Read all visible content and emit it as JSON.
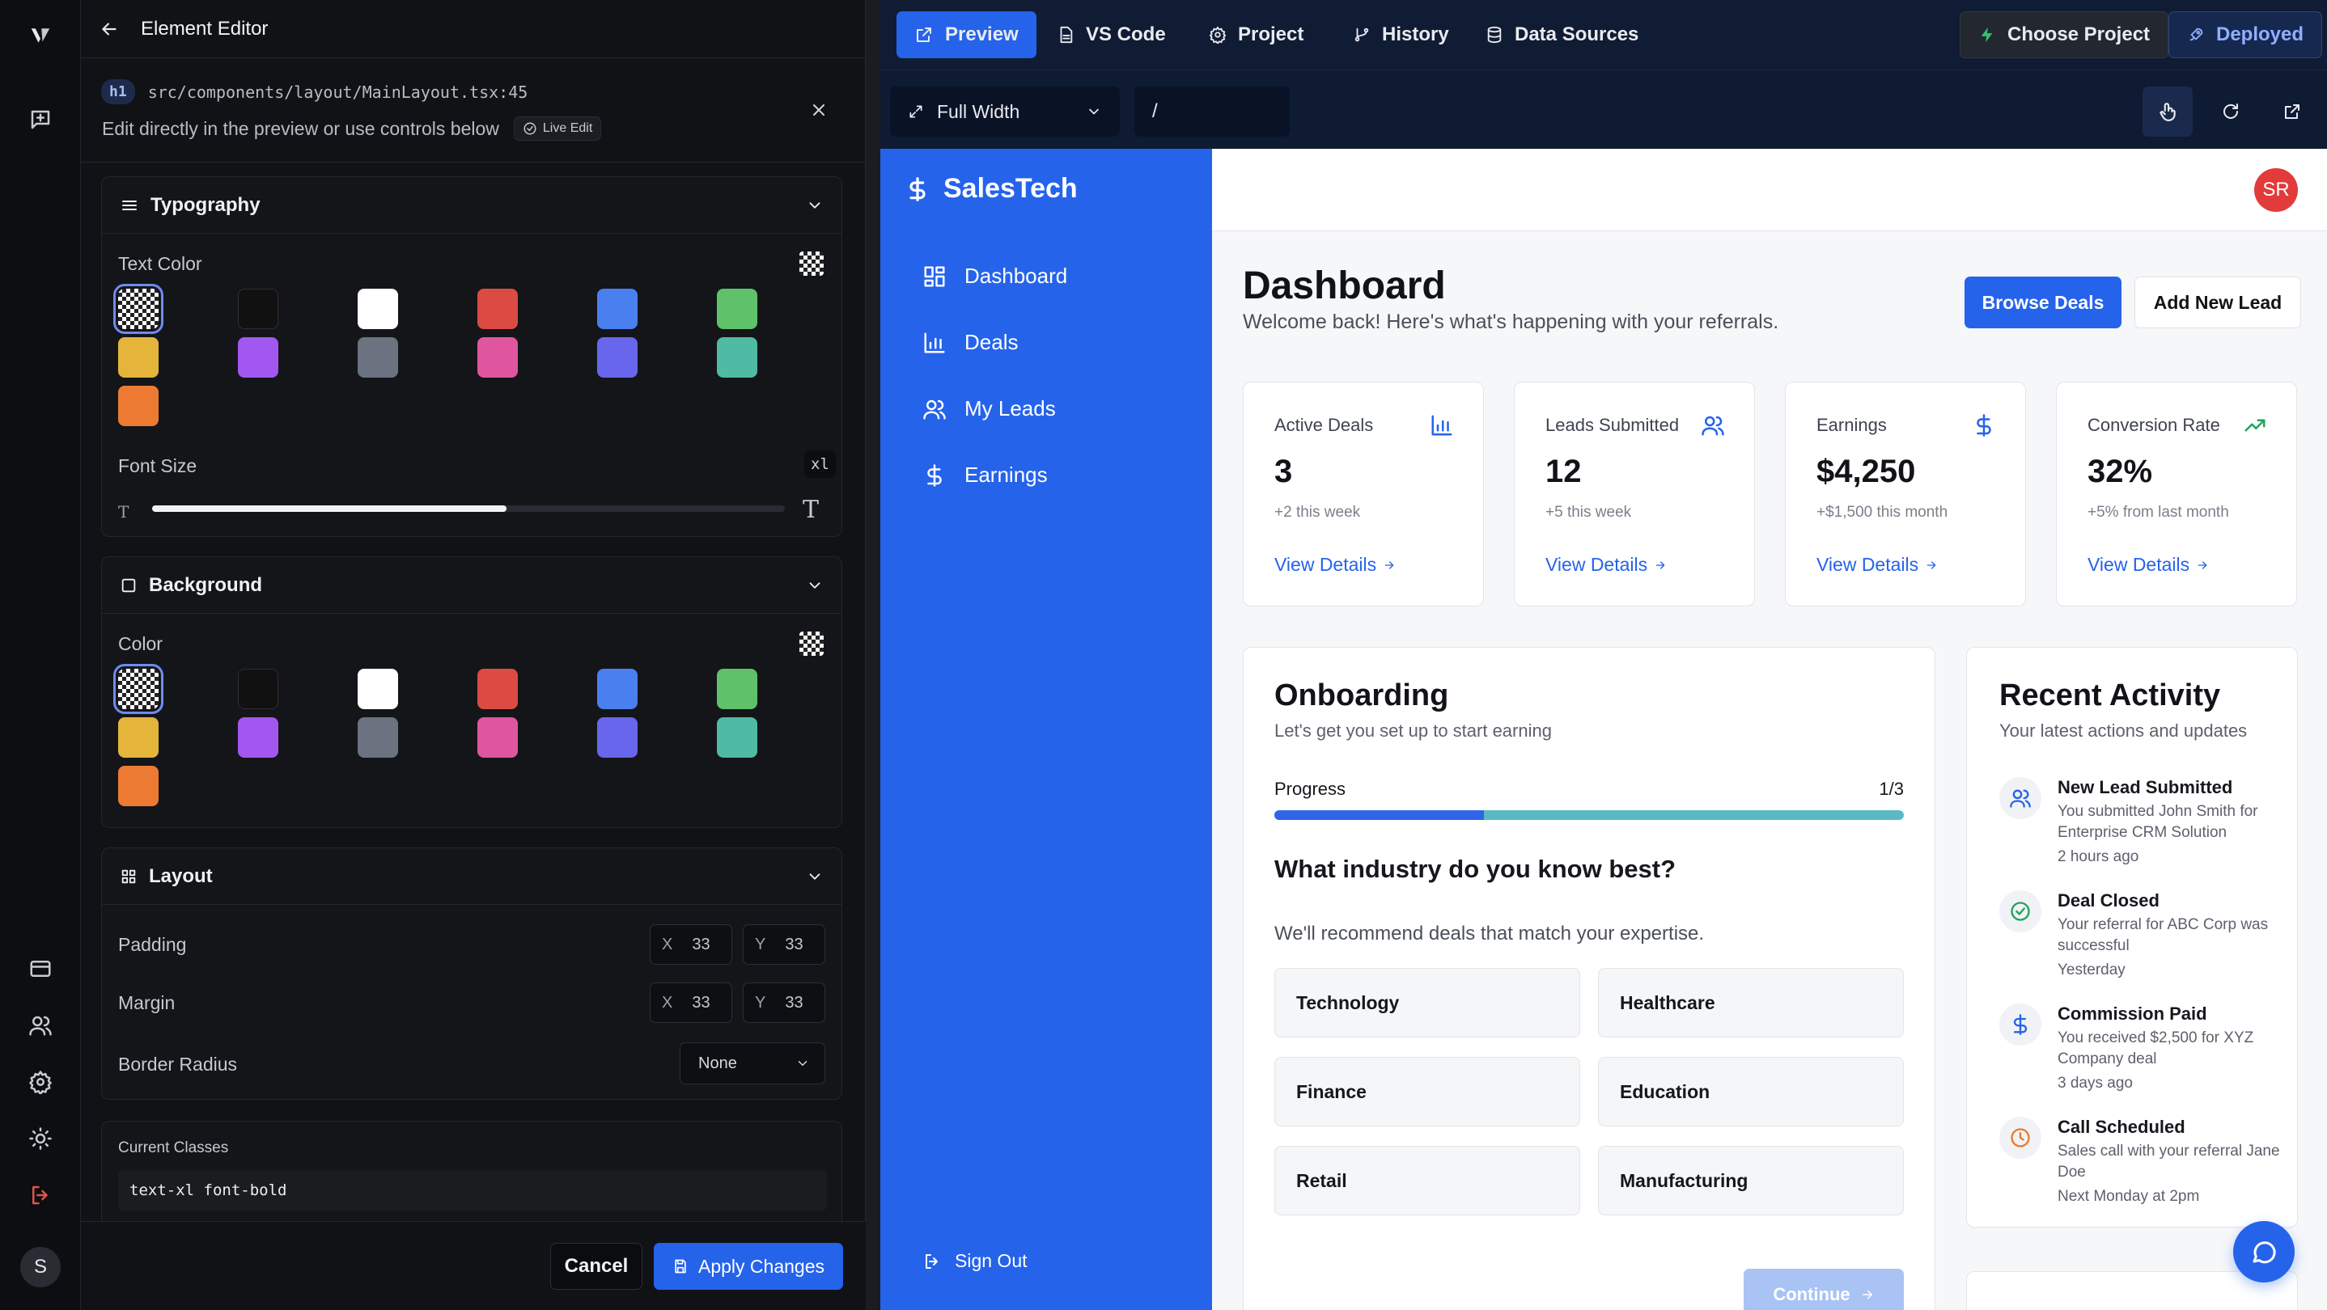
{
  "rail": {
    "logo": "V",
    "user_initial": "S"
  },
  "editor": {
    "title": "Element Editor",
    "tag": "h1",
    "path": "src/components/layout/MainLayout.tsx:45",
    "hint": "Edit directly in the preview or use controls below",
    "live_badge": "Live Edit",
    "typography": {
      "title": "Typography",
      "text_color_label": "Text Color",
      "font_size_label": "Font Size",
      "font_size_value": "xl",
      "font_size_fraction": 0.56
    },
    "background": {
      "title": "Background",
      "color_label": "Color"
    },
    "swatches": [
      "transparent",
      "#111111",
      "#ffffff",
      "#dc4b43",
      "#4a7ff0",
      "#5fc16a",
      "#e5b43a",
      "#a257f0",
      "#6b7280",
      "#e0569e",
      "#6766ec",
      "#4fbba4",
      "#ec7a32"
    ],
    "layout": {
      "title": "Layout",
      "padding_label": "Padding",
      "margin_label": "Margin",
      "radius_label": "Border Radius",
      "x_label": "X",
      "y_label": "Y",
      "padding_x": "33",
      "padding_y": "33",
      "margin_x": "33",
      "margin_y": "33",
      "radius_value": "None"
    },
    "classes_label": "Current Classes",
    "classes_value": "text-xl font-bold",
    "cancel": "Cancel",
    "apply": "Apply Changes"
  },
  "topbar": {
    "tabs": [
      "Preview",
      "VS Code",
      "Project",
      "History",
      "Data Sources"
    ],
    "choose_project": "Choose Project",
    "deployed": "Deployed",
    "width_select": "Full Width",
    "route": "/"
  },
  "app": {
    "brand": "SalesTech",
    "nav": [
      "Dashboard",
      "Deals",
      "My Leads",
      "Earnings"
    ],
    "sign_out": "Sign Out",
    "avatar": "SR",
    "title": "Dashboard",
    "subtitle": "Welcome back! Here's what's happening with your referrals.",
    "browse_deals": "Browse Deals",
    "add_lead": "Add New Lead",
    "stats": [
      {
        "title": "Active Deals",
        "value": "3",
        "sub": "+2 this week",
        "link": "View Details"
      },
      {
        "title": "Leads Submitted",
        "value": "12",
        "sub": "+5 this week",
        "link": "View Details"
      },
      {
        "title": "Earnings",
        "value": "$4,250",
        "sub": "+$1,500 this month",
        "link": "View Details"
      },
      {
        "title": "Conversion Rate",
        "value": "32%",
        "sub": "+5% from last month",
        "link": "View Details"
      }
    ],
    "onboarding": {
      "title": "Onboarding",
      "subtitle": "Let's get you set up to start earning",
      "progress_label": "Progress",
      "progress_text": "1/3",
      "progress_fraction": 0.333,
      "question": "What industry do you know best?",
      "hint": "We'll recommend deals that match your expertise.",
      "options": [
        "Technology",
        "Healthcare",
        "Finance",
        "Education",
        "Retail",
        "Manufacturing"
      ],
      "continue": "Continue"
    },
    "activity": {
      "title": "Recent Activity",
      "subtitle": "Your latest actions and updates",
      "items": [
        {
          "title": "New Lead Submitted",
          "desc": "You submitted John Smith for Enterprise CRM Solution",
          "when": "2 hours ago"
        },
        {
          "title": "Deal Closed",
          "desc": "Your referral for ABC Corp was successful",
          "when": "Yesterday"
        },
        {
          "title": "Commission Paid",
          "desc": "You received $2,500 for XYZ Company deal",
          "when": "3 days ago"
        },
        {
          "title": "Call Scheduled",
          "desc": "Sales call with your referral Jane Doe",
          "when": "Next Monday at 2pm"
        }
      ]
    },
    "colors": {
      "brand": "#2563eb",
      "progress_done": "#2f66e8",
      "progress_rest": "#5bb9c5"
    }
  }
}
